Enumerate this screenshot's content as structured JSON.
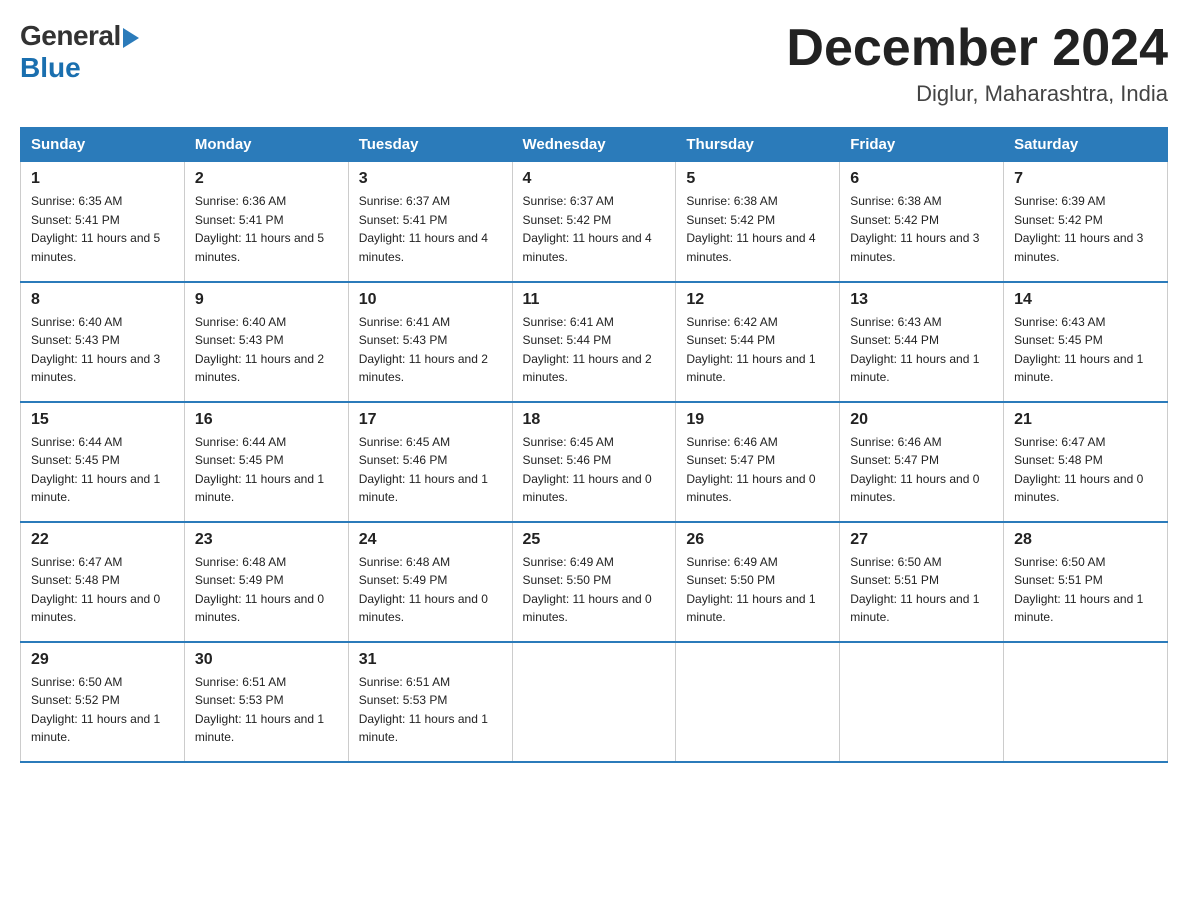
{
  "header": {
    "logo_general": "General",
    "logo_blue": "Blue",
    "title": "December 2024",
    "location": "Diglur, Maharashtra, India"
  },
  "days_of_week": [
    "Sunday",
    "Monday",
    "Tuesday",
    "Wednesday",
    "Thursday",
    "Friday",
    "Saturday"
  ],
  "weeks": [
    [
      {
        "day": "1",
        "sunrise": "6:35 AM",
        "sunset": "5:41 PM",
        "daylight": "11 hours and 5 minutes."
      },
      {
        "day": "2",
        "sunrise": "6:36 AM",
        "sunset": "5:41 PM",
        "daylight": "11 hours and 5 minutes."
      },
      {
        "day": "3",
        "sunrise": "6:37 AM",
        "sunset": "5:41 PM",
        "daylight": "11 hours and 4 minutes."
      },
      {
        "day": "4",
        "sunrise": "6:37 AM",
        "sunset": "5:42 PM",
        "daylight": "11 hours and 4 minutes."
      },
      {
        "day": "5",
        "sunrise": "6:38 AM",
        "sunset": "5:42 PM",
        "daylight": "11 hours and 4 minutes."
      },
      {
        "day": "6",
        "sunrise": "6:38 AM",
        "sunset": "5:42 PM",
        "daylight": "11 hours and 3 minutes."
      },
      {
        "day": "7",
        "sunrise": "6:39 AM",
        "sunset": "5:42 PM",
        "daylight": "11 hours and 3 minutes."
      }
    ],
    [
      {
        "day": "8",
        "sunrise": "6:40 AM",
        "sunset": "5:43 PM",
        "daylight": "11 hours and 3 minutes."
      },
      {
        "day": "9",
        "sunrise": "6:40 AM",
        "sunset": "5:43 PM",
        "daylight": "11 hours and 2 minutes."
      },
      {
        "day": "10",
        "sunrise": "6:41 AM",
        "sunset": "5:43 PM",
        "daylight": "11 hours and 2 minutes."
      },
      {
        "day": "11",
        "sunrise": "6:41 AM",
        "sunset": "5:44 PM",
        "daylight": "11 hours and 2 minutes."
      },
      {
        "day": "12",
        "sunrise": "6:42 AM",
        "sunset": "5:44 PM",
        "daylight": "11 hours and 1 minute."
      },
      {
        "day": "13",
        "sunrise": "6:43 AM",
        "sunset": "5:44 PM",
        "daylight": "11 hours and 1 minute."
      },
      {
        "day": "14",
        "sunrise": "6:43 AM",
        "sunset": "5:45 PM",
        "daylight": "11 hours and 1 minute."
      }
    ],
    [
      {
        "day": "15",
        "sunrise": "6:44 AM",
        "sunset": "5:45 PM",
        "daylight": "11 hours and 1 minute."
      },
      {
        "day": "16",
        "sunrise": "6:44 AM",
        "sunset": "5:45 PM",
        "daylight": "11 hours and 1 minute."
      },
      {
        "day": "17",
        "sunrise": "6:45 AM",
        "sunset": "5:46 PM",
        "daylight": "11 hours and 1 minute."
      },
      {
        "day": "18",
        "sunrise": "6:45 AM",
        "sunset": "5:46 PM",
        "daylight": "11 hours and 0 minutes."
      },
      {
        "day": "19",
        "sunrise": "6:46 AM",
        "sunset": "5:47 PM",
        "daylight": "11 hours and 0 minutes."
      },
      {
        "day": "20",
        "sunrise": "6:46 AM",
        "sunset": "5:47 PM",
        "daylight": "11 hours and 0 minutes."
      },
      {
        "day": "21",
        "sunrise": "6:47 AM",
        "sunset": "5:48 PM",
        "daylight": "11 hours and 0 minutes."
      }
    ],
    [
      {
        "day": "22",
        "sunrise": "6:47 AM",
        "sunset": "5:48 PM",
        "daylight": "11 hours and 0 minutes."
      },
      {
        "day": "23",
        "sunrise": "6:48 AM",
        "sunset": "5:49 PM",
        "daylight": "11 hours and 0 minutes."
      },
      {
        "day": "24",
        "sunrise": "6:48 AM",
        "sunset": "5:49 PM",
        "daylight": "11 hours and 0 minutes."
      },
      {
        "day": "25",
        "sunrise": "6:49 AM",
        "sunset": "5:50 PM",
        "daylight": "11 hours and 0 minutes."
      },
      {
        "day": "26",
        "sunrise": "6:49 AM",
        "sunset": "5:50 PM",
        "daylight": "11 hours and 1 minute."
      },
      {
        "day": "27",
        "sunrise": "6:50 AM",
        "sunset": "5:51 PM",
        "daylight": "11 hours and 1 minute."
      },
      {
        "day": "28",
        "sunrise": "6:50 AM",
        "sunset": "5:51 PM",
        "daylight": "11 hours and 1 minute."
      }
    ],
    [
      {
        "day": "29",
        "sunrise": "6:50 AM",
        "sunset": "5:52 PM",
        "daylight": "11 hours and 1 minute."
      },
      {
        "day": "30",
        "sunrise": "6:51 AM",
        "sunset": "5:53 PM",
        "daylight": "11 hours and 1 minute."
      },
      {
        "day": "31",
        "sunrise": "6:51 AM",
        "sunset": "5:53 PM",
        "daylight": "11 hours and 1 minute."
      },
      null,
      null,
      null,
      null
    ]
  ]
}
